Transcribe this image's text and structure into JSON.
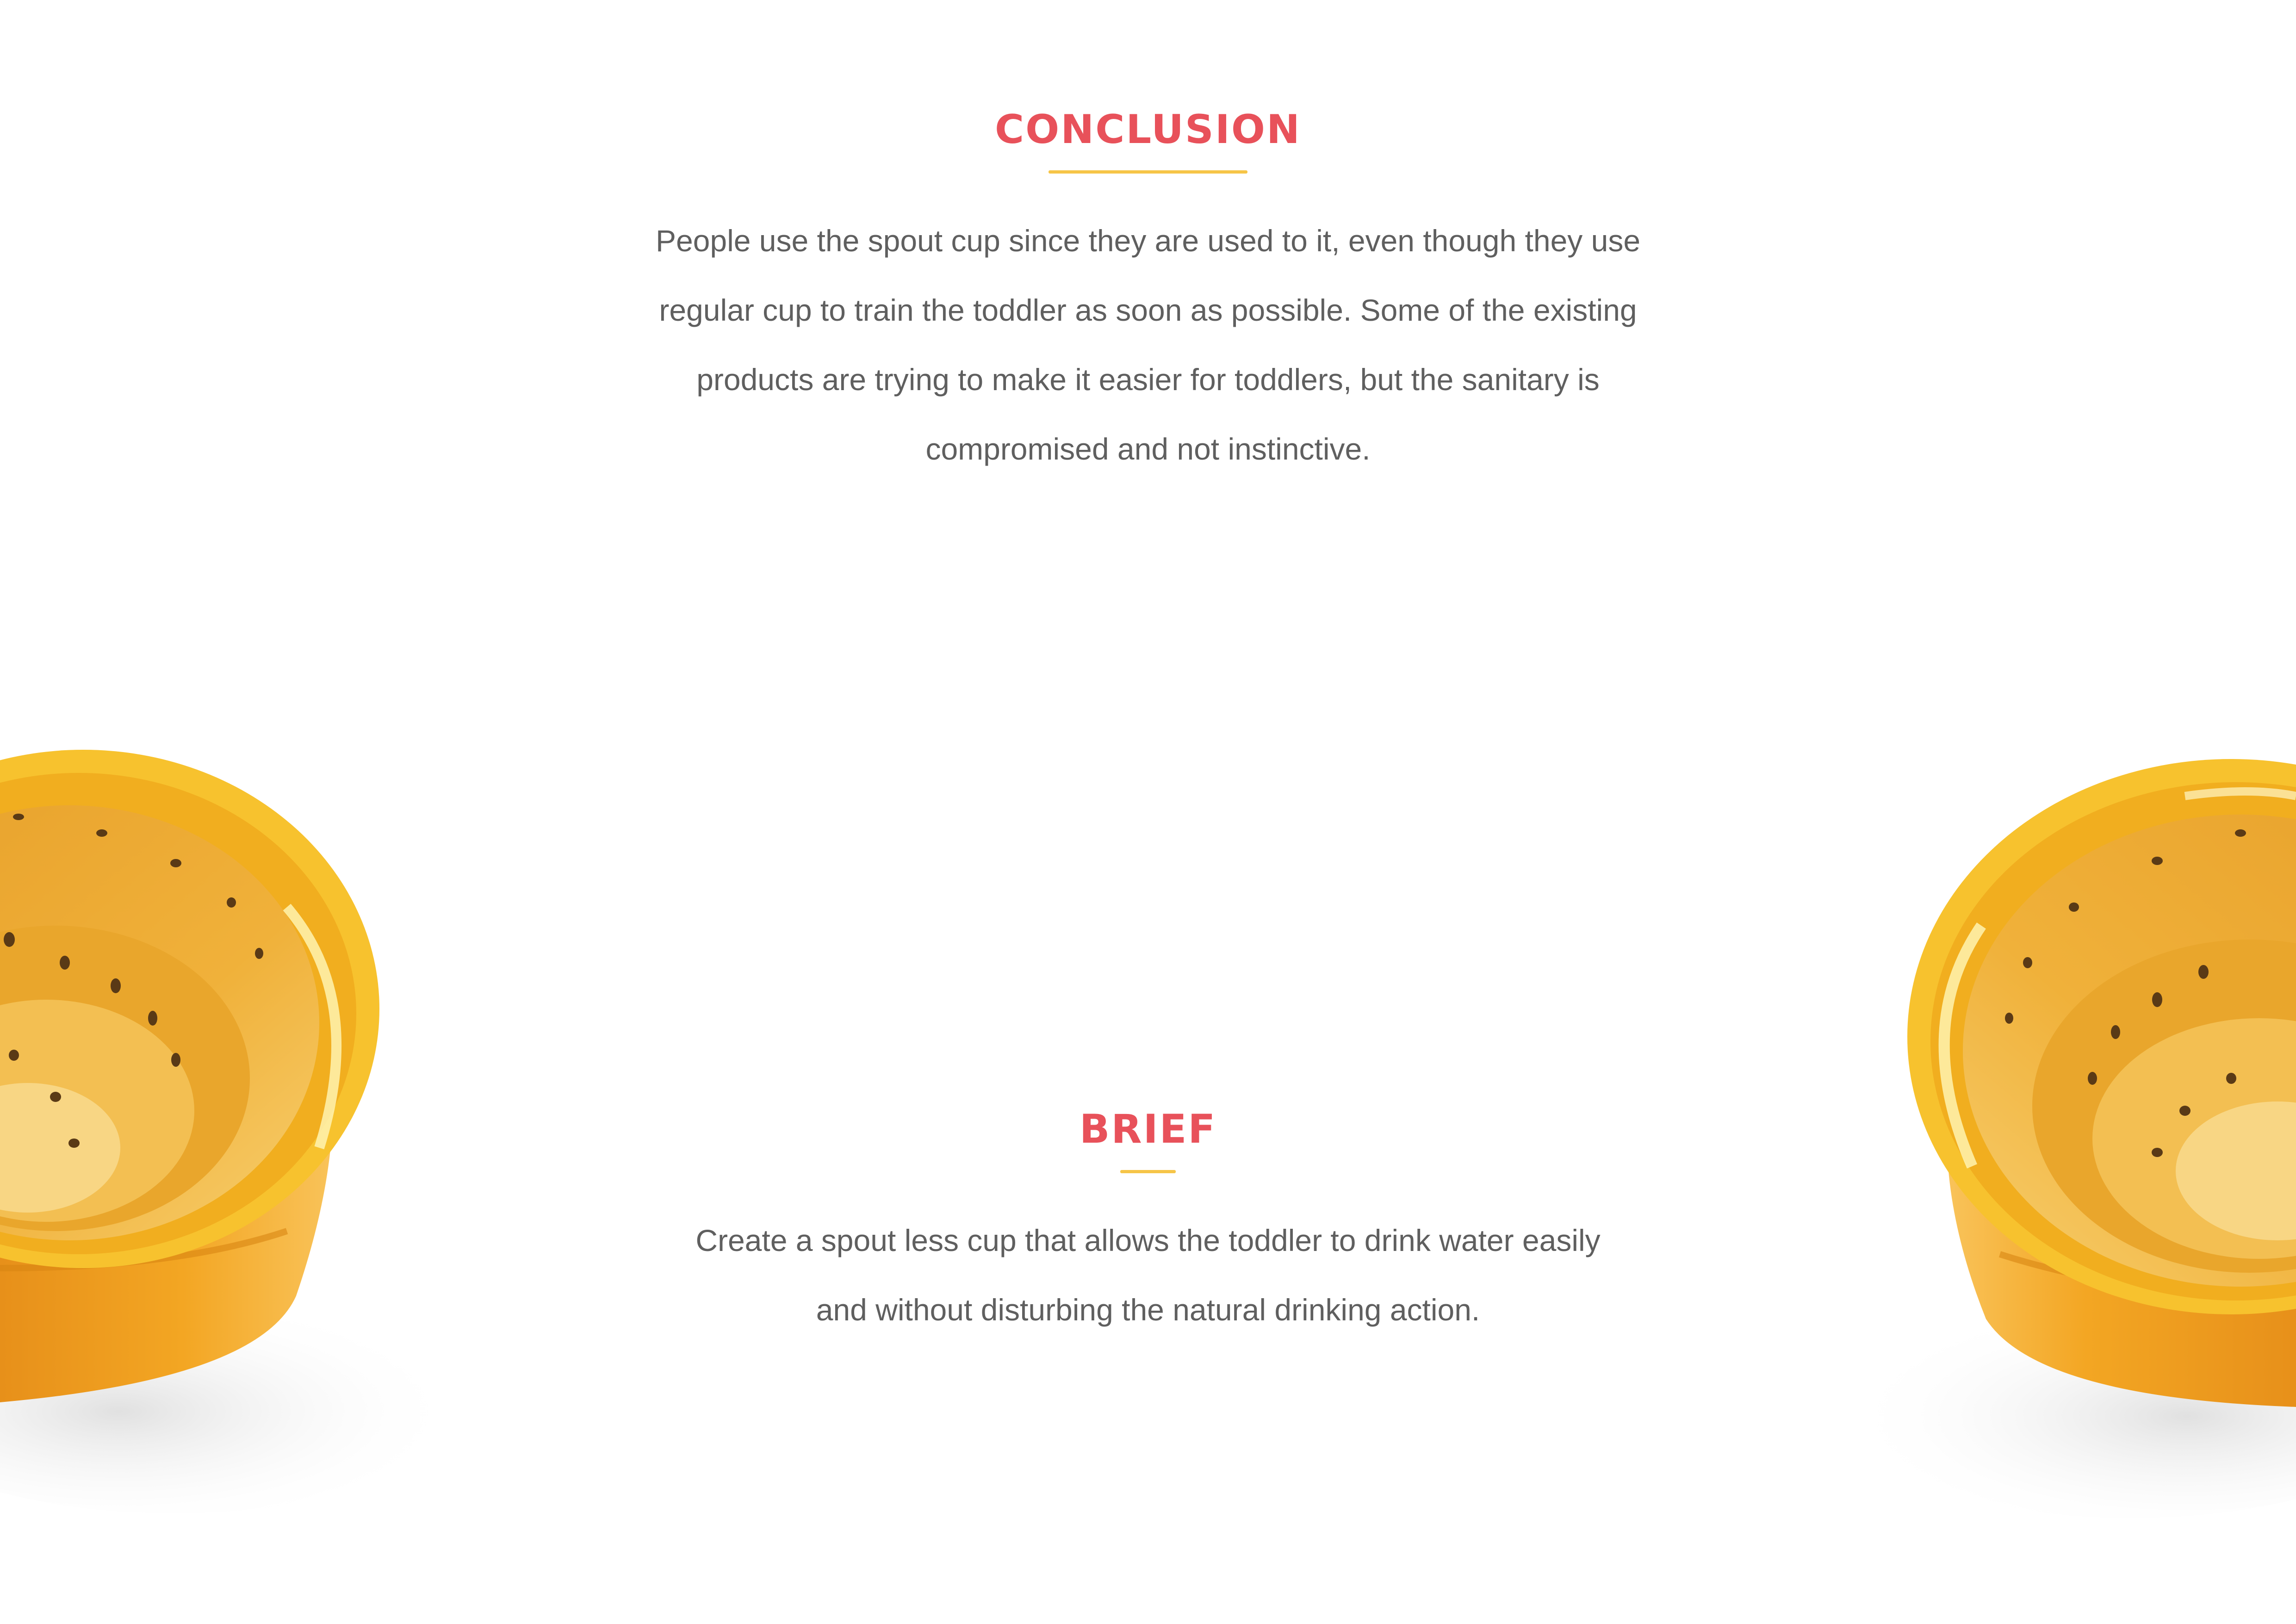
{
  "conclusion": {
    "heading": "CONCLUSION",
    "body": "People use the spout cup since they are used to it, even though they use regular cup to train the toddler as soon as possible. Some of the existing products are trying to make it easier for toddlers, but the sanitary is compromised and not instinctive."
  },
  "brief": {
    "heading": "BRIEF",
    "body": "Create a spout less cup that allows the toddler to drink water easily and without disturbing the natural drinking action."
  },
  "colors": {
    "heading": "#e8515a",
    "accent_rule": "#f6c548",
    "body_text": "#5f5f5f",
    "cup_yellow": "#f4b01c",
    "cup_orange": "#ef9a12"
  }
}
